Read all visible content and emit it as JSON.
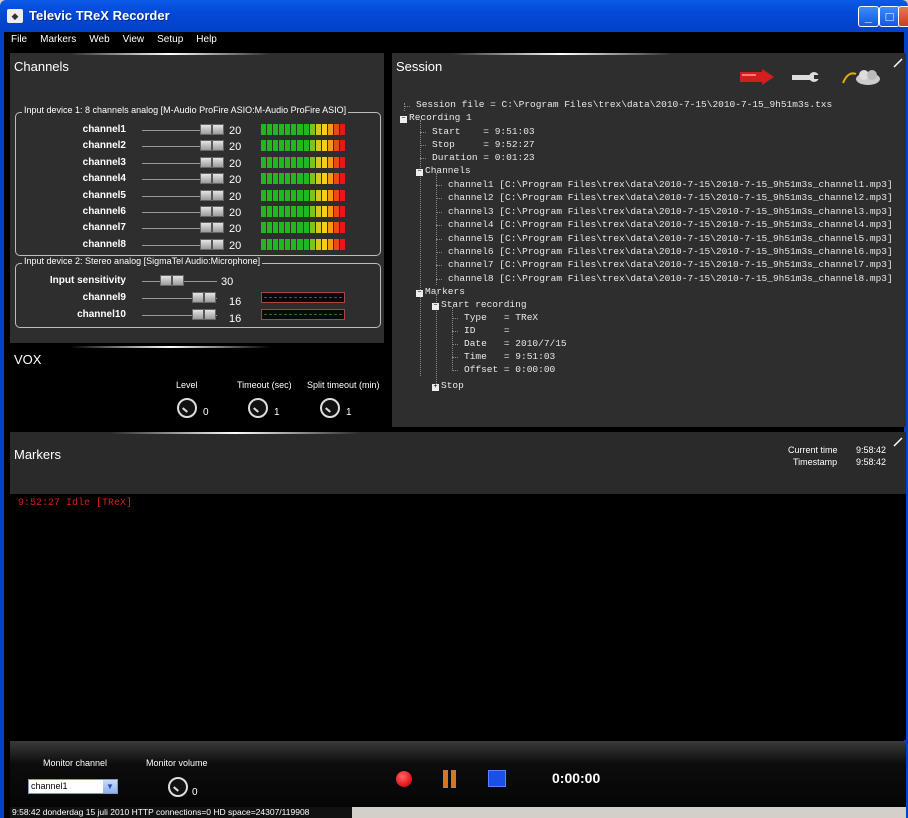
{
  "window": {
    "title": "Televic TReX Recorder",
    "icon": "trex-app-icon",
    "btn_min": "_",
    "btn_max": "□",
    "btn_close": "X"
  },
  "menu": [
    "File",
    "Markers",
    "Web",
    "View",
    "Setup",
    "Help"
  ],
  "channels": {
    "title": "Channels",
    "device1": {
      "label": "Input device 1: 8 channels analog [M-Audio ProFire ASIO:M-Audio ProFire ASIO]",
      "rows": [
        {
          "name": "channel1",
          "value": "20"
        },
        {
          "name": "channel2",
          "value": "20"
        },
        {
          "name": "channel3",
          "value": "20"
        },
        {
          "name": "channel4",
          "value": "20"
        },
        {
          "name": "channel5",
          "value": "20"
        },
        {
          "name": "channel6",
          "value": "20"
        },
        {
          "name": "channel7",
          "value": "20"
        },
        {
          "name": "channel8",
          "value": "20"
        }
      ]
    },
    "device2": {
      "label": "Input device 2: Stereo analog [SigmaTel Audio:Microphone]",
      "sensitivity_label": "Input sensitivity",
      "sensitivity_value": "30",
      "rows": [
        {
          "name": "channel9",
          "value": "16"
        },
        {
          "name": "channel10",
          "value": "16"
        }
      ]
    }
  },
  "vox": {
    "title": "VOX",
    "level_label": "Level",
    "level_value": "0",
    "timeout_label": "Timeout (sec)",
    "timeout_value": "1",
    "split_label": "Split timeout (min)",
    "split_value": "1"
  },
  "session": {
    "title": "Session",
    "file": "Session file = C:\\Program Files\\trex\\data\\2010-7-15\\2010-7-15_9h51m3s.txs",
    "recording": "Recording 1",
    "start": "Start    = 9:51:03",
    "stop": "Stop     = 9:52:27",
    "duration": "Duration = 0:01:23",
    "channels_label": "Channels",
    "channel_files": [
      "channel1 [C:\\Program Files\\trex\\data\\2010-7-15\\2010-7-15_9h51m3s_channel1.mp3]",
      "channel2 [C:\\Program Files\\trex\\data\\2010-7-15\\2010-7-15_9h51m3s_channel2.mp3]",
      "channel3 [C:\\Program Files\\trex\\data\\2010-7-15\\2010-7-15_9h51m3s_channel3.mp3]",
      "channel4 [C:\\Program Files\\trex\\data\\2010-7-15\\2010-7-15_9h51m3s_channel4.mp3]",
      "channel5 [C:\\Program Files\\trex\\data\\2010-7-15\\2010-7-15_9h51m3s_channel5.mp3]",
      "channel6 [C:\\Program Files\\trex\\data\\2010-7-15\\2010-7-15_9h51m3s_channel6.mp3]",
      "channel7 [C:\\Program Files\\trex\\data\\2010-7-15\\2010-7-15_9h51m3s_channel7.mp3]",
      "channel8 [C:\\Program Files\\trex\\data\\2010-7-15\\2010-7-15_9h51m3s_channel8.mp3]"
    ],
    "markers_label": "Markers",
    "start_recording": "Start recording",
    "type": "Type   = TReX",
    "id": "ID     =",
    "date": "Date   = 2010/7/15",
    "time": "Time   = 9:51:03",
    "offset": "Offset = 0:00:00",
    "stop_marker": "Stop",
    "tool_icons": [
      "export-red-icon",
      "wrench-icon",
      "upload-cloud-icon"
    ]
  },
  "markers": {
    "title": "Markers",
    "current_time_label": "Current time",
    "current_time": "9:58:42",
    "timestamp_label": "Timestamp",
    "timestamp": "9:58:42",
    "entry": "9:52:27 Idle [TReX]"
  },
  "bottom": {
    "monitor_channel_label": "Monitor channel",
    "monitor_channel_value": "channel1",
    "monitor_volume_label": "Monitor volume",
    "monitor_volume_value": "0",
    "elapsed": "0:00:00",
    "record_color": "#e8181c",
    "pause_color": "#d9731c",
    "stop_color": "#1a4fe8"
  },
  "status": "9:58:42  donderdag 15 juli 2010  HTTP connections=0  HD space=24307/119908"
}
